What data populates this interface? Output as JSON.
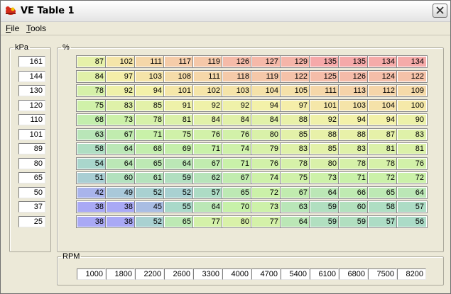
{
  "window": {
    "title": "VE Table 1"
  },
  "menu": [
    {
      "label_first": "F",
      "label_rest": "ile"
    },
    {
      "label_first": "T",
      "label_rest": "ools"
    }
  ],
  "kpa_group": {
    "legend": "kPa",
    "values": [
      "161",
      "144",
      "130",
      "120",
      "110",
      "101",
      "89",
      "80",
      "65",
      "50",
      "37",
      "25"
    ]
  },
  "table_group": {
    "legend": "%"
  },
  "rpm_group": {
    "legend": "RPM",
    "values": [
      "1000",
      "1800",
      "2200",
      "2600",
      "3300",
      "4000",
      "4700",
      "5400",
      "6100",
      "6800",
      "7500",
      "8200"
    ]
  },
  "ve_table": [
    [
      "87",
      "102",
      "111",
      "117",
      "119",
      "126",
      "127",
      "129",
      "135",
      "135",
      "134",
      "134"
    ],
    [
      "84",
      "97",
      "103",
      "108",
      "111",
      "118",
      "119",
      "122",
      "125",
      "126",
      "124",
      "122"
    ],
    [
      "78",
      "92",
      "94",
      "101",
      "102",
      "103",
      "104",
      "105",
      "111",
      "113",
      "112",
      "109"
    ],
    [
      "75",
      "83",
      "85",
      "91",
      "92",
      "92",
      "94",
      "97",
      "101",
      "103",
      "104",
      "100"
    ],
    [
      "68",
      "73",
      "78",
      "81",
      "84",
      "84",
      "84",
      "88",
      "92",
      "94",
      "94",
      "90"
    ],
    [
      "63",
      "67",
      "71",
      "75",
      "76",
      "76",
      "80",
      "85",
      "88",
      "88",
      "87",
      "83"
    ],
    [
      "58",
      "64",
      "68",
      "69",
      "71",
      "74",
      "79",
      "83",
      "85",
      "83",
      "81",
      "81"
    ],
    [
      "54",
      "64",
      "65",
      "64",
      "67",
      "71",
      "76",
      "78",
      "80",
      "78",
      "78",
      "76"
    ],
    [
      "51",
      "60",
      "61",
      "59",
      "62",
      "67",
      "74",
      "75",
      "73",
      "71",
      "72",
      "72"
    ],
    [
      "42",
      "49",
      "52",
      "52",
      "57",
      "65",
      "72",
      "67",
      "64",
      "66",
      "65",
      "64"
    ],
    [
      "38",
      "38",
      "45",
      "55",
      "64",
      "70",
      "73",
      "63",
      "59",
      "60",
      "58",
      "57"
    ],
    [
      "38",
      "38",
      "52",
      "65",
      "77",
      "80",
      "77",
      "64",
      "59",
      "59",
      "57",
      "56"
    ]
  ],
  "colors": {
    "low": "#a9a9f5",
    "mid_green": "#c7f1a9",
    "teal": "#a9d9c9",
    "yellow": "#f5f1a9",
    "orange": "#f5d0a9",
    "high": "#f5a9a9"
  }
}
